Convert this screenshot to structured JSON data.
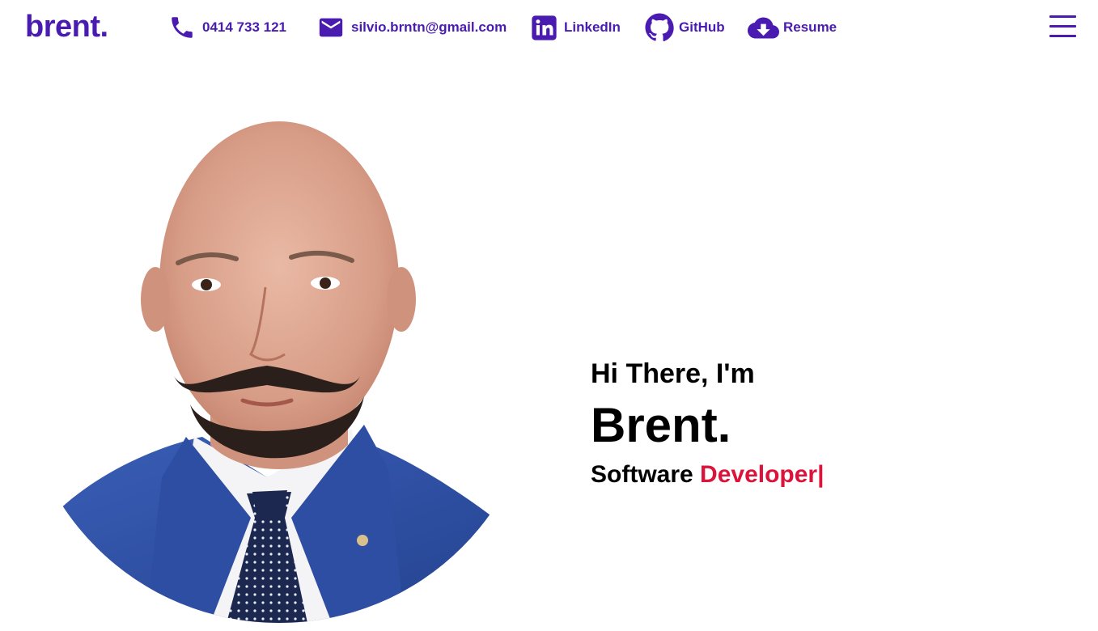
{
  "header": {
    "logo": "brent.",
    "nav": [
      {
        "label": "0414 733 121",
        "icon": "phone-icon"
      },
      {
        "label": "silvio.brntn@gmail.com",
        "icon": "mail-icon"
      },
      {
        "label": "LinkedIn",
        "icon": "linkedin-icon"
      },
      {
        "label": "GitHub",
        "icon": "github-icon"
      },
      {
        "label": "Resume",
        "icon": "cloud-download-icon"
      }
    ],
    "menu_icon": "hamburger-menu-icon"
  },
  "hero": {
    "greeting": "Hi There, I'm",
    "name": "Brent.",
    "role_prefix": "Software ",
    "role_highlight": "Developer|"
  },
  "colors": {
    "brand": "#4a1bb0",
    "accent": "#dc143c",
    "text": "#000000",
    "background": "#ffffff"
  }
}
